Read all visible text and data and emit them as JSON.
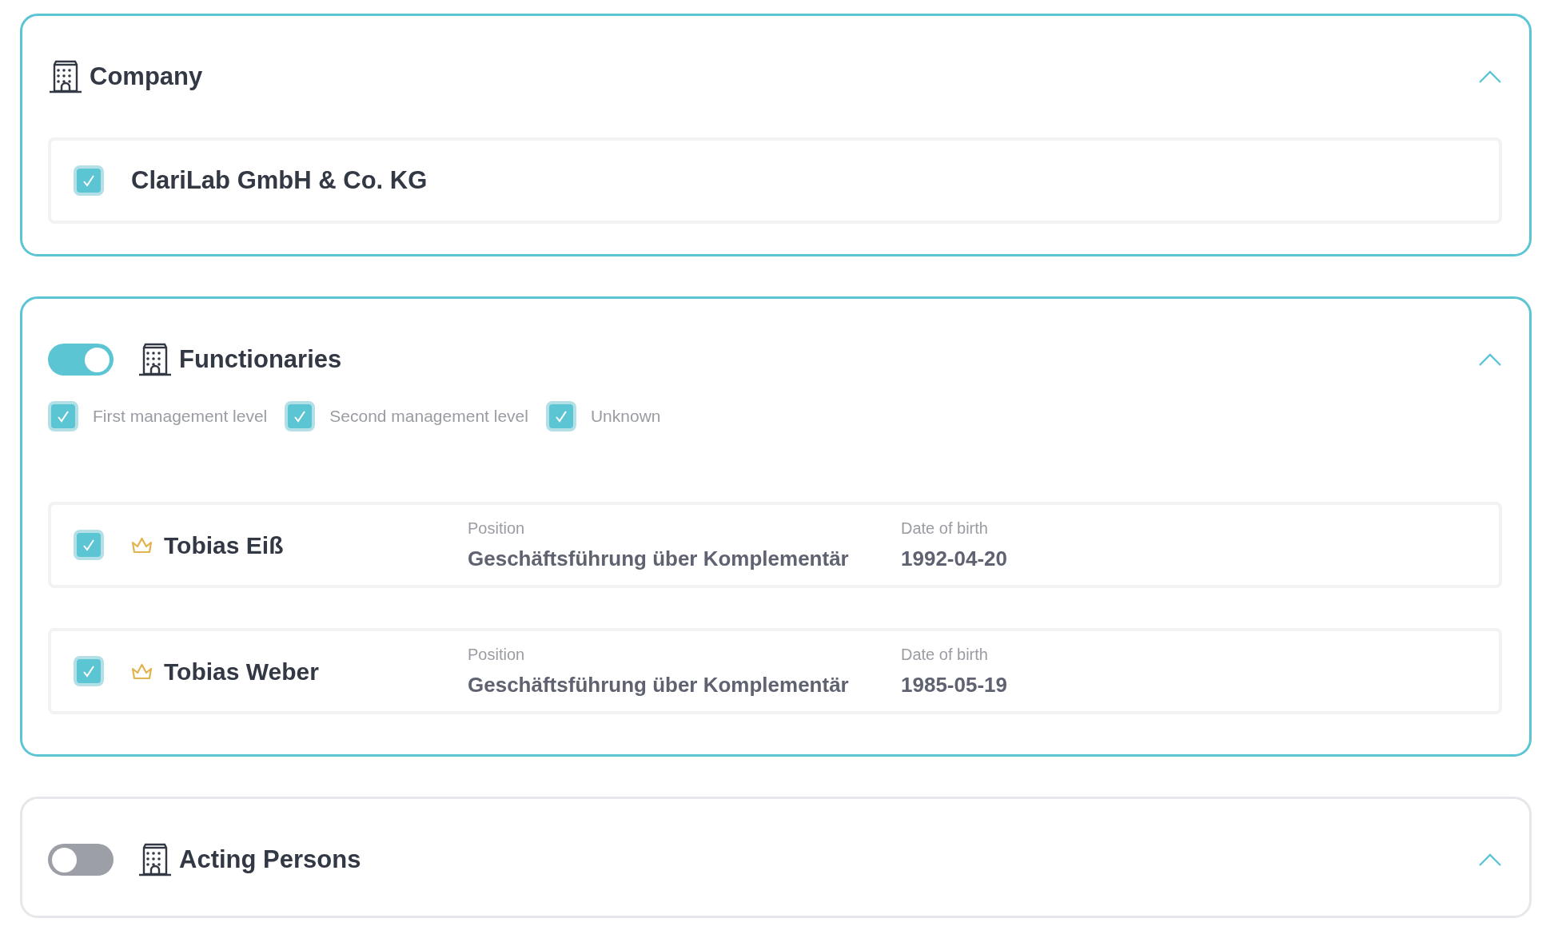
{
  "sections": [
    {
      "kind": "plain",
      "title": "Company",
      "expanded": true,
      "items": [
        {
          "kind": "company",
          "name": "ClariLab GmbH & Co. KG",
          "checked": true
        }
      ]
    },
    {
      "kind": "toggle",
      "on": true,
      "title": "Functionaries",
      "expanded": true,
      "filters": [
        {
          "label": "First management level",
          "checked": true
        },
        {
          "label": "Second management level",
          "checked": true
        },
        {
          "label": "Unknown",
          "checked": true
        }
      ],
      "items": [
        {
          "kind": "person",
          "name": "Tobias Eiß",
          "checked": true,
          "position_label": "Position",
          "position": "Geschäftsführung über Komplementär",
          "dob_label": "Date of birth",
          "dob": "1992-04-20"
        },
        {
          "kind": "person",
          "name": "Tobias Weber",
          "checked": true,
          "position_label": "Position",
          "position": "Geschäftsführung über Komplementär",
          "dob_label": "Date of birth",
          "dob": "1985-05-19"
        }
      ]
    },
    {
      "kind": "toggle",
      "on": false,
      "title": "Acting Persons",
      "expanded": true
    }
  ]
}
